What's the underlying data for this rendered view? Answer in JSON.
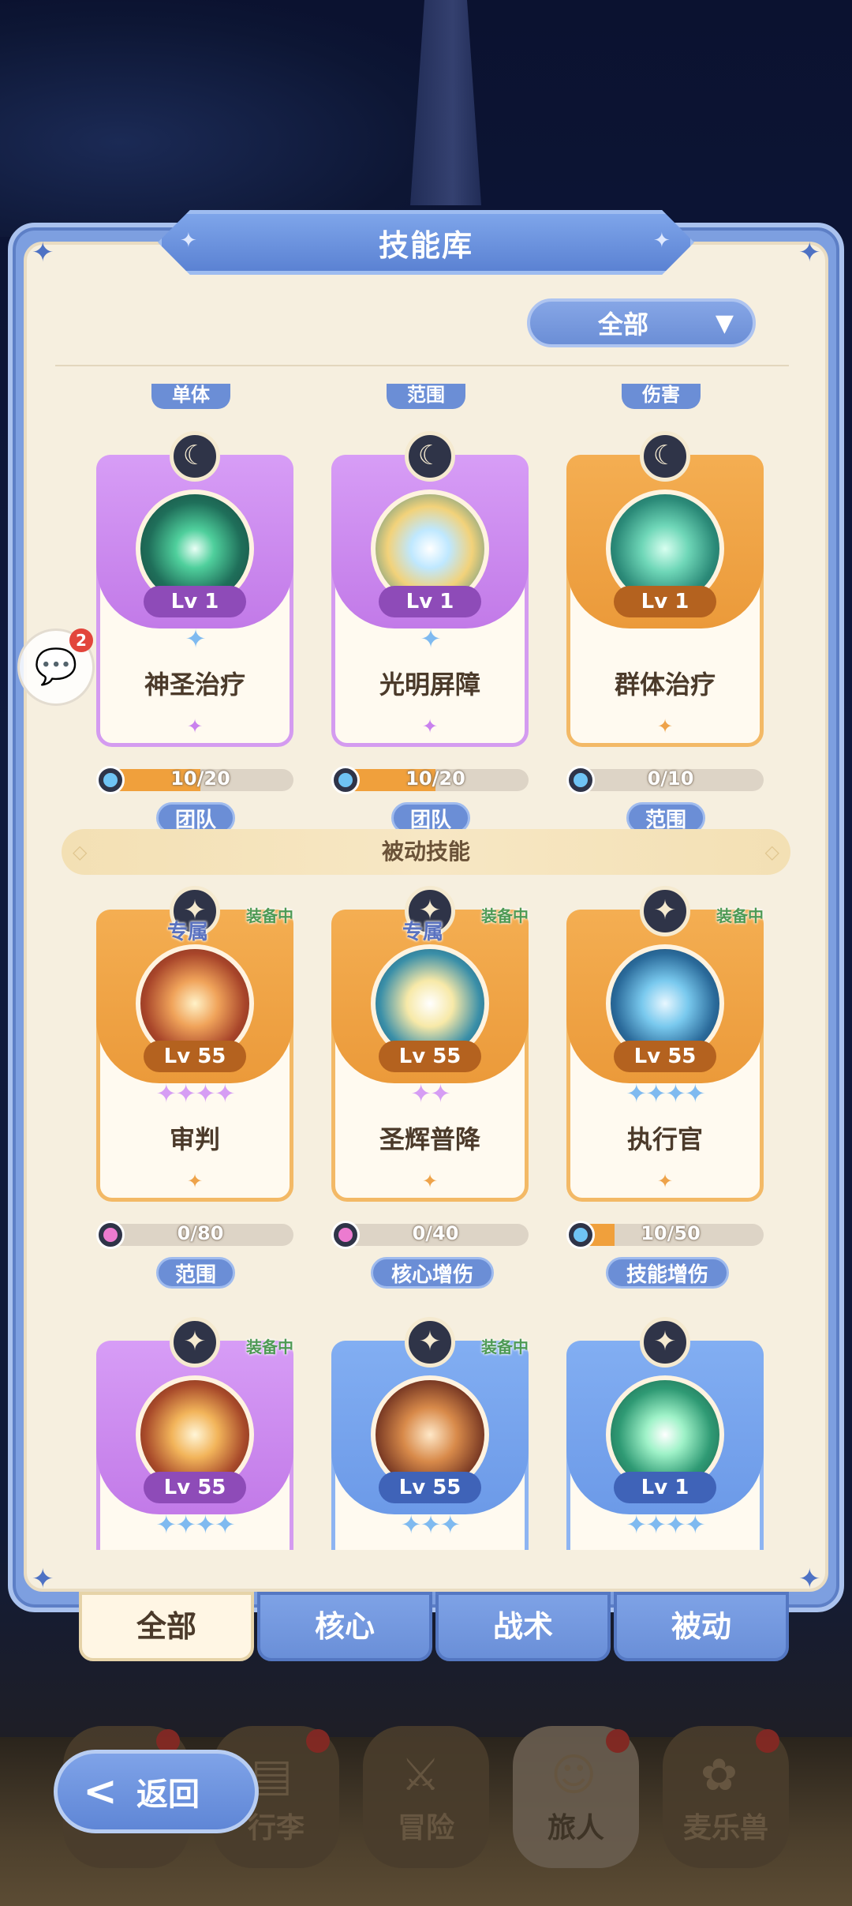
{
  "header": {
    "title": "技能库"
  },
  "filter": {
    "selected": "全部",
    "arrow": "▼"
  },
  "top_peek_tags": [
    "单体",
    "范围",
    "伤害"
  ],
  "active_cards": [
    {
      "name": "神圣治疗",
      "level": "Lv 1",
      "rarity": "purple",
      "badge": "☾",
      "stars": "✦",
      "progress_text": "10/20",
      "progress": 0.5,
      "gem": "blue",
      "tag": "团队"
    },
    {
      "name": "光明屏障",
      "level": "Lv 1",
      "rarity": "purple",
      "badge": "☾",
      "stars": "✦",
      "progress_text": "10/20",
      "progress": 0.5,
      "gem": "blue",
      "tag": "团队"
    },
    {
      "name": "群体治疗",
      "level": "Lv 1",
      "rarity": "orange",
      "badge": "☾",
      "stars": "",
      "progress_text": "0/10",
      "progress": 0,
      "gem": "blue",
      "tag": "范围"
    }
  ],
  "section": {
    "passive_title": "被动技能"
  },
  "passive_cards": [
    {
      "name": "审判",
      "level": "Lv 55",
      "rarity": "orange",
      "badge": "✦",
      "exclusive": "专属",
      "equipped": "装备中",
      "stars": "✦✦✦✦",
      "star_color": "p",
      "progress_text": "0/80",
      "progress": 0,
      "gem": "pink",
      "tag": "范围"
    },
    {
      "name": "圣辉普降",
      "level": "Lv 55",
      "rarity": "orange",
      "badge": "✦",
      "exclusive": "专属",
      "equipped": "装备中",
      "stars": "✦✦",
      "star_color": "p",
      "progress_text": "0/40",
      "progress": 0,
      "gem": "pink",
      "tag": "核心增伤"
    },
    {
      "name": "执行官",
      "level": "Lv 55",
      "rarity": "orange",
      "badge": "✦",
      "exclusive": "",
      "equipped": "装备中",
      "stars": "✦✦✦✦",
      "star_color": "b",
      "progress_text": "10/50",
      "progress": 0.2,
      "gem": "blue",
      "tag": "技能增伤"
    }
  ],
  "bottom_cards": [
    {
      "level": "Lv 55",
      "rarity": "purple",
      "badge": "✦",
      "equipped": "装备中",
      "stars": "✦✦✦✦",
      "star_color": "b"
    },
    {
      "level": "Lv 55",
      "rarity": "blue",
      "badge": "✦",
      "equipped": "装备中",
      "stars": "✦✦✦",
      "star_color": "b"
    },
    {
      "level": "Lv 1",
      "rarity": "blue",
      "badge": "✦",
      "equipped": "",
      "stars": "✦✦✦✦",
      "star_color": "b"
    }
  ],
  "tabs": [
    {
      "label": "全部",
      "active": true
    },
    {
      "label": "核心",
      "active": false
    },
    {
      "label": "战术",
      "active": false
    },
    {
      "label": "被动",
      "active": false
    }
  ],
  "chat": {
    "badge_count": "2"
  },
  "back_button": {
    "label": "返回"
  },
  "bottom_nav": [
    {
      "label": "",
      "icon": "inventory-icon"
    },
    {
      "label": "行李",
      "icon": "luggage-icon"
    },
    {
      "label": "冒险",
      "icon": "swords-icon"
    },
    {
      "label": "旅人",
      "icon": "traveler-icon"
    },
    {
      "label": "麦乐兽",
      "icon": "pet-icon"
    }
  ],
  "colors": {
    "purple_card": "#c27ae8",
    "orange_card": "#eb9a3a",
    "blue_card": "#6c9ae8",
    "accent_blue": "#6b8ed6",
    "panel_bg": "#f6efdf"
  }
}
